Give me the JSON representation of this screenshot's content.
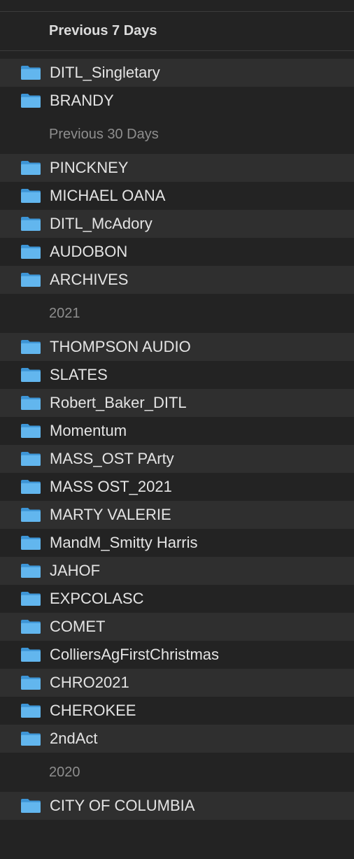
{
  "folder_color": "#5fb3ec",
  "folder_icon": "folder-icon",
  "groups": [
    {
      "label": "Previous 7 Days",
      "items": [
        "DITL_Singletary",
        "BRANDY"
      ]
    },
    {
      "label": "Previous 30 Days",
      "items": [
        "PINCKNEY",
        "MICHAEL OANA",
        "DITL_McAdory",
        "AUDOBON",
        "ARCHIVES"
      ]
    },
    {
      "label": "2021",
      "items": [
        "THOMPSON AUDIO",
        "SLATES",
        "Robert_Baker_DITL",
        "Momentum",
        "MASS_OST PArty",
        "MASS OST_2021",
        "MARTY VALERIE",
        "MandM_Smitty Harris",
        "JAHOF",
        "EXPCOLASC",
        "COMET",
        "ColliersAgFirstChristmas",
        "CHRO2021",
        "CHEROKEE",
        "2ndAct"
      ]
    },
    {
      "label": "2020",
      "items": [
        "CITY OF COLUMBIA"
      ]
    }
  ]
}
